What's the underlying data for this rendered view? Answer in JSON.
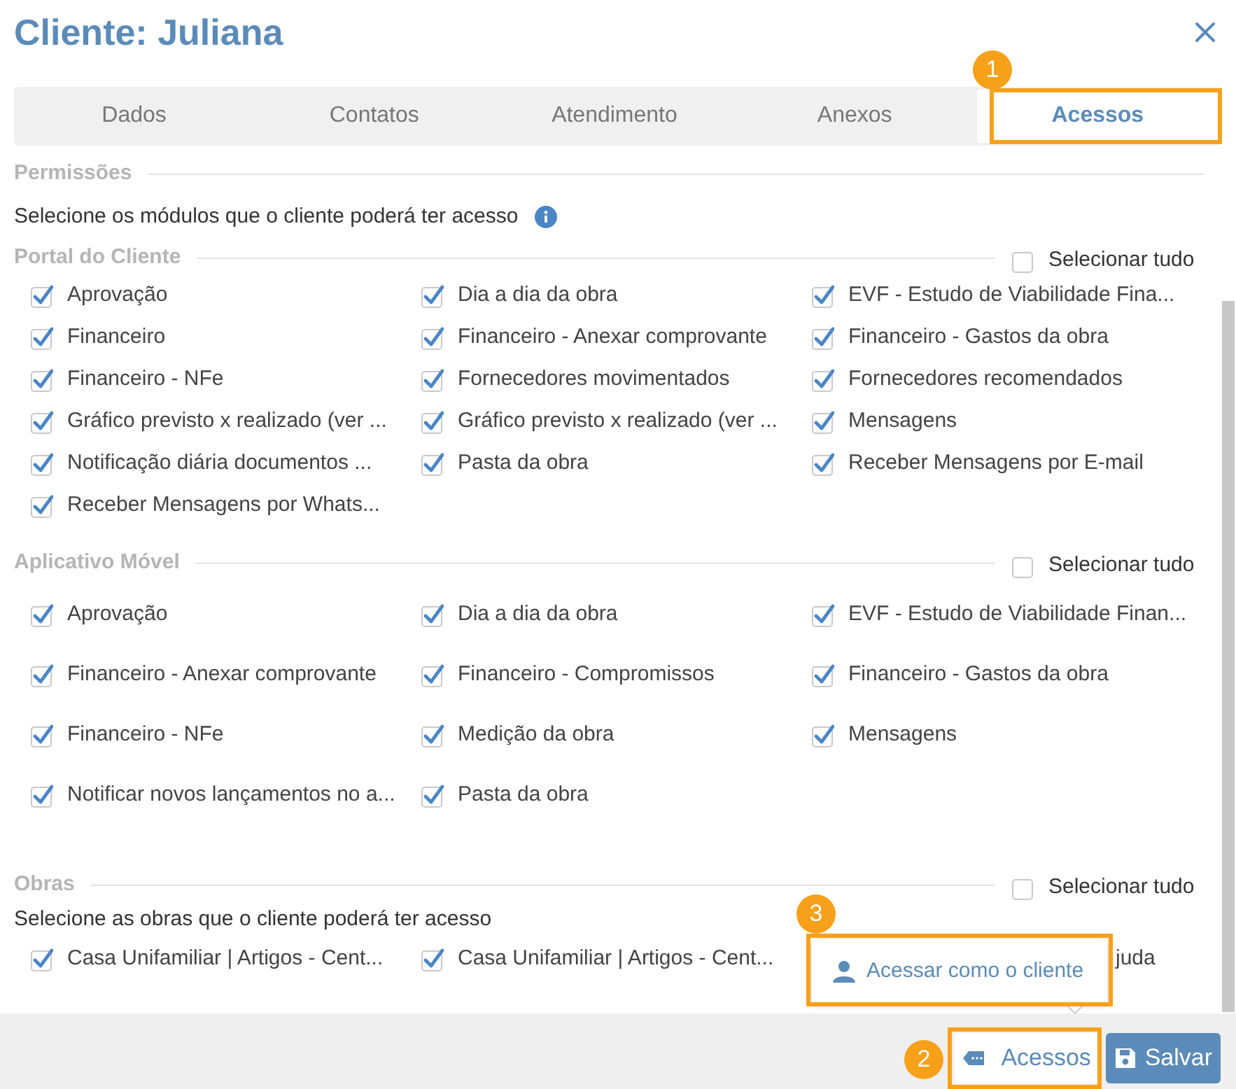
{
  "title": "Cliente: Juliana",
  "tabs": [
    {
      "label": "Dados",
      "selected": false
    },
    {
      "label": "Contatos",
      "selected": false
    },
    {
      "label": "Atendimento",
      "selected": false
    },
    {
      "label": "Anexos",
      "selected": false
    },
    {
      "label": "Acessos",
      "selected": true
    }
  ],
  "permissions": {
    "heading": "Permissões",
    "description": "Selecione os módulos que o cliente poderá ter acesso"
  },
  "groups": [
    {
      "heading": "Portal do Cliente",
      "select_all": {
        "label": "Selecionar tudo",
        "checked": false
      },
      "items": [
        {
          "label": "Aprovação",
          "checked": true
        },
        {
          "label": "Dia a dia da obra",
          "checked": true
        },
        {
          "label": "EVF - Estudo de Viabilidade Fina...",
          "checked": true
        },
        {
          "label": "Financeiro",
          "checked": true
        },
        {
          "label": "Financeiro - Anexar comprovante",
          "checked": true
        },
        {
          "label": "Financeiro - Gastos da obra",
          "checked": true
        },
        {
          "label": "Financeiro - NFe",
          "checked": true
        },
        {
          "label": "Fornecedores movimentados",
          "checked": true
        },
        {
          "label": "Fornecedores recomendados",
          "checked": true
        },
        {
          "label": "Gráfico previsto x realizado (ver ...",
          "checked": true
        },
        {
          "label": "Gráfico previsto x realizado (ver ...",
          "checked": true
        },
        {
          "label": "Mensagens",
          "checked": true
        },
        {
          "label": "Notificação diária documentos ...",
          "checked": true
        },
        {
          "label": "Pasta da obra",
          "checked": true
        },
        {
          "label": "Receber Mensagens por E-mail",
          "checked": true
        },
        {
          "label": "Receber Mensagens por Whats...",
          "checked": true
        }
      ]
    },
    {
      "heading": "Aplicativo Móvel",
      "select_all": {
        "label": "Selecionar tudo",
        "checked": false
      },
      "items": [
        {
          "label": "Aprovação",
          "checked": true
        },
        {
          "label": "Dia a dia da obra",
          "checked": true
        },
        {
          "label": "EVF - Estudo de Viabilidade Finan...",
          "checked": true
        },
        {
          "label": "Financeiro - Anexar comprovante",
          "checked": true
        },
        {
          "label": "Financeiro - Compromissos",
          "checked": true
        },
        {
          "label": "Financeiro - Gastos da obra",
          "checked": true
        },
        {
          "label": "Financeiro - NFe",
          "checked": true
        },
        {
          "label": "Medição da obra",
          "checked": true
        },
        {
          "label": "Mensagens",
          "checked": true
        },
        {
          "label": "Notificar novos lançamentos no a...",
          "checked": true
        },
        {
          "label": "Pasta da obra",
          "checked": true
        }
      ]
    },
    {
      "heading": "Obras",
      "select_all": {
        "label": "Selecionar tudo",
        "checked": false
      },
      "description": "Selecione as obras que o cliente poderá ter acesso",
      "items": [
        {
          "label": "Casa Unifamiliar | Artigos - Cent...",
          "checked": true
        },
        {
          "label": "Casa Unifamiliar | Artigos - Cent...",
          "checked": true
        }
      ],
      "obscured_text": "juda"
    }
  ],
  "popover": {
    "label": "Acessar como o cliente"
  },
  "buttons": [
    {
      "label": "Acessos",
      "kind": "secondary"
    },
    {
      "label": "Salvar",
      "kind": "primary"
    }
  ],
  "annotations": [
    {
      "number": "1"
    },
    {
      "number": "2"
    },
    {
      "number": "3"
    }
  ]
}
